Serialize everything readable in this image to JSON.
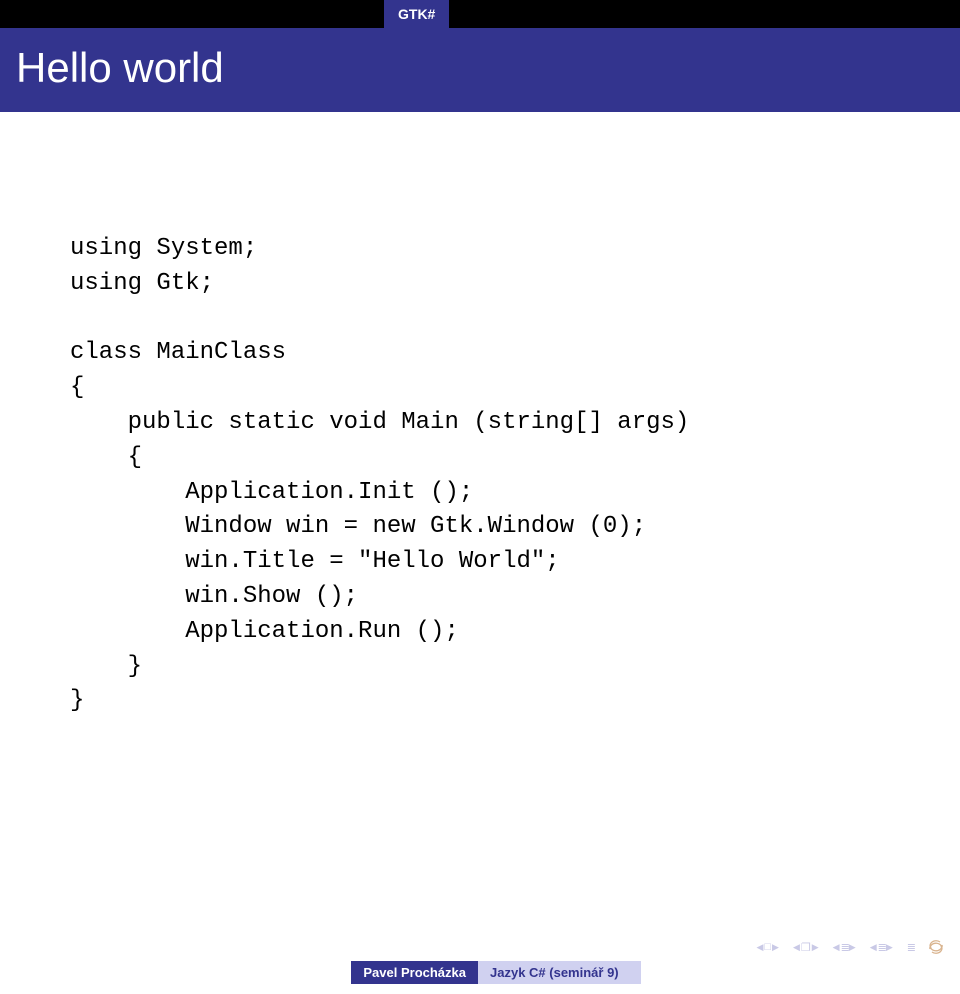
{
  "tabstrip": {
    "active_tab": "GTK#"
  },
  "title": "Hello world",
  "code": "using System;\nusing Gtk;\n\nclass MainClass\n{\n    public static void Main (string[] args)\n    {\n        Application.Init ();\n        Window win = new Gtk.Window (0);\n        win.Title = \"Hello World\";\n        win.Show ();\n        Application.Run ();\n    }\n}",
  "footer": {
    "author": "Pavel Procházka",
    "topic": "Jazyk C# (seminář 9)"
  }
}
